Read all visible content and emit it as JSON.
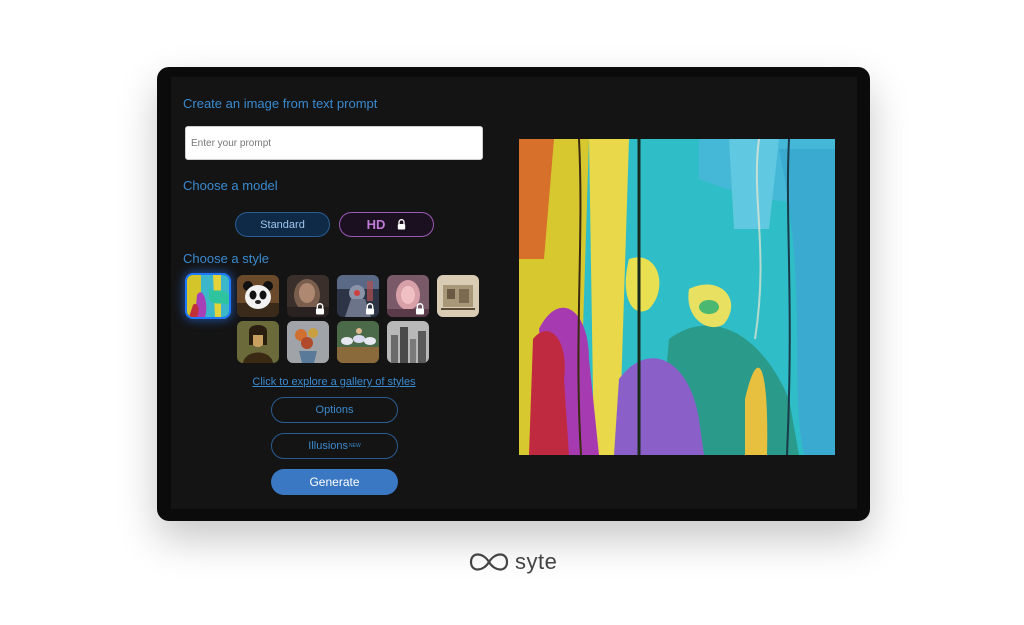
{
  "headings": {
    "create": "Create an image from text prompt",
    "model": "Choose a model",
    "style": "Choose a style"
  },
  "prompt": {
    "placeholder": "Enter your prompt",
    "value": ""
  },
  "models": {
    "standard": "Standard",
    "hd": "HD",
    "hd_locked": true,
    "selected": "Standard"
  },
  "styles": [
    {
      "name": "abstract-paint",
      "selected": true,
      "locked": false
    },
    {
      "name": "panda",
      "locked": false
    },
    {
      "name": "blurred-portrait",
      "locked": true
    },
    {
      "name": "robot-warrior",
      "locked": true
    },
    {
      "name": "soft-portrait",
      "locked": true
    },
    {
      "name": "vintage-sketch",
      "locked": false
    },
    {
      "name": "mona-lisa",
      "locked": false
    },
    {
      "name": "still-life",
      "locked": false
    },
    {
      "name": "ballet-dancers",
      "locked": false
    },
    {
      "name": "city-sketch",
      "locked": false
    }
  ],
  "gallery_link": "Click to explore a gallery of styles",
  "buttons": {
    "options": "Options",
    "illusions": "Illusions",
    "illusions_badge": "NEW",
    "generate": "Generate"
  },
  "brand": {
    "name": "syte"
  },
  "colors": {
    "accent": "#3a8ad0",
    "generate_bg": "#3a78c4",
    "hd_border": "#9b59b6"
  }
}
